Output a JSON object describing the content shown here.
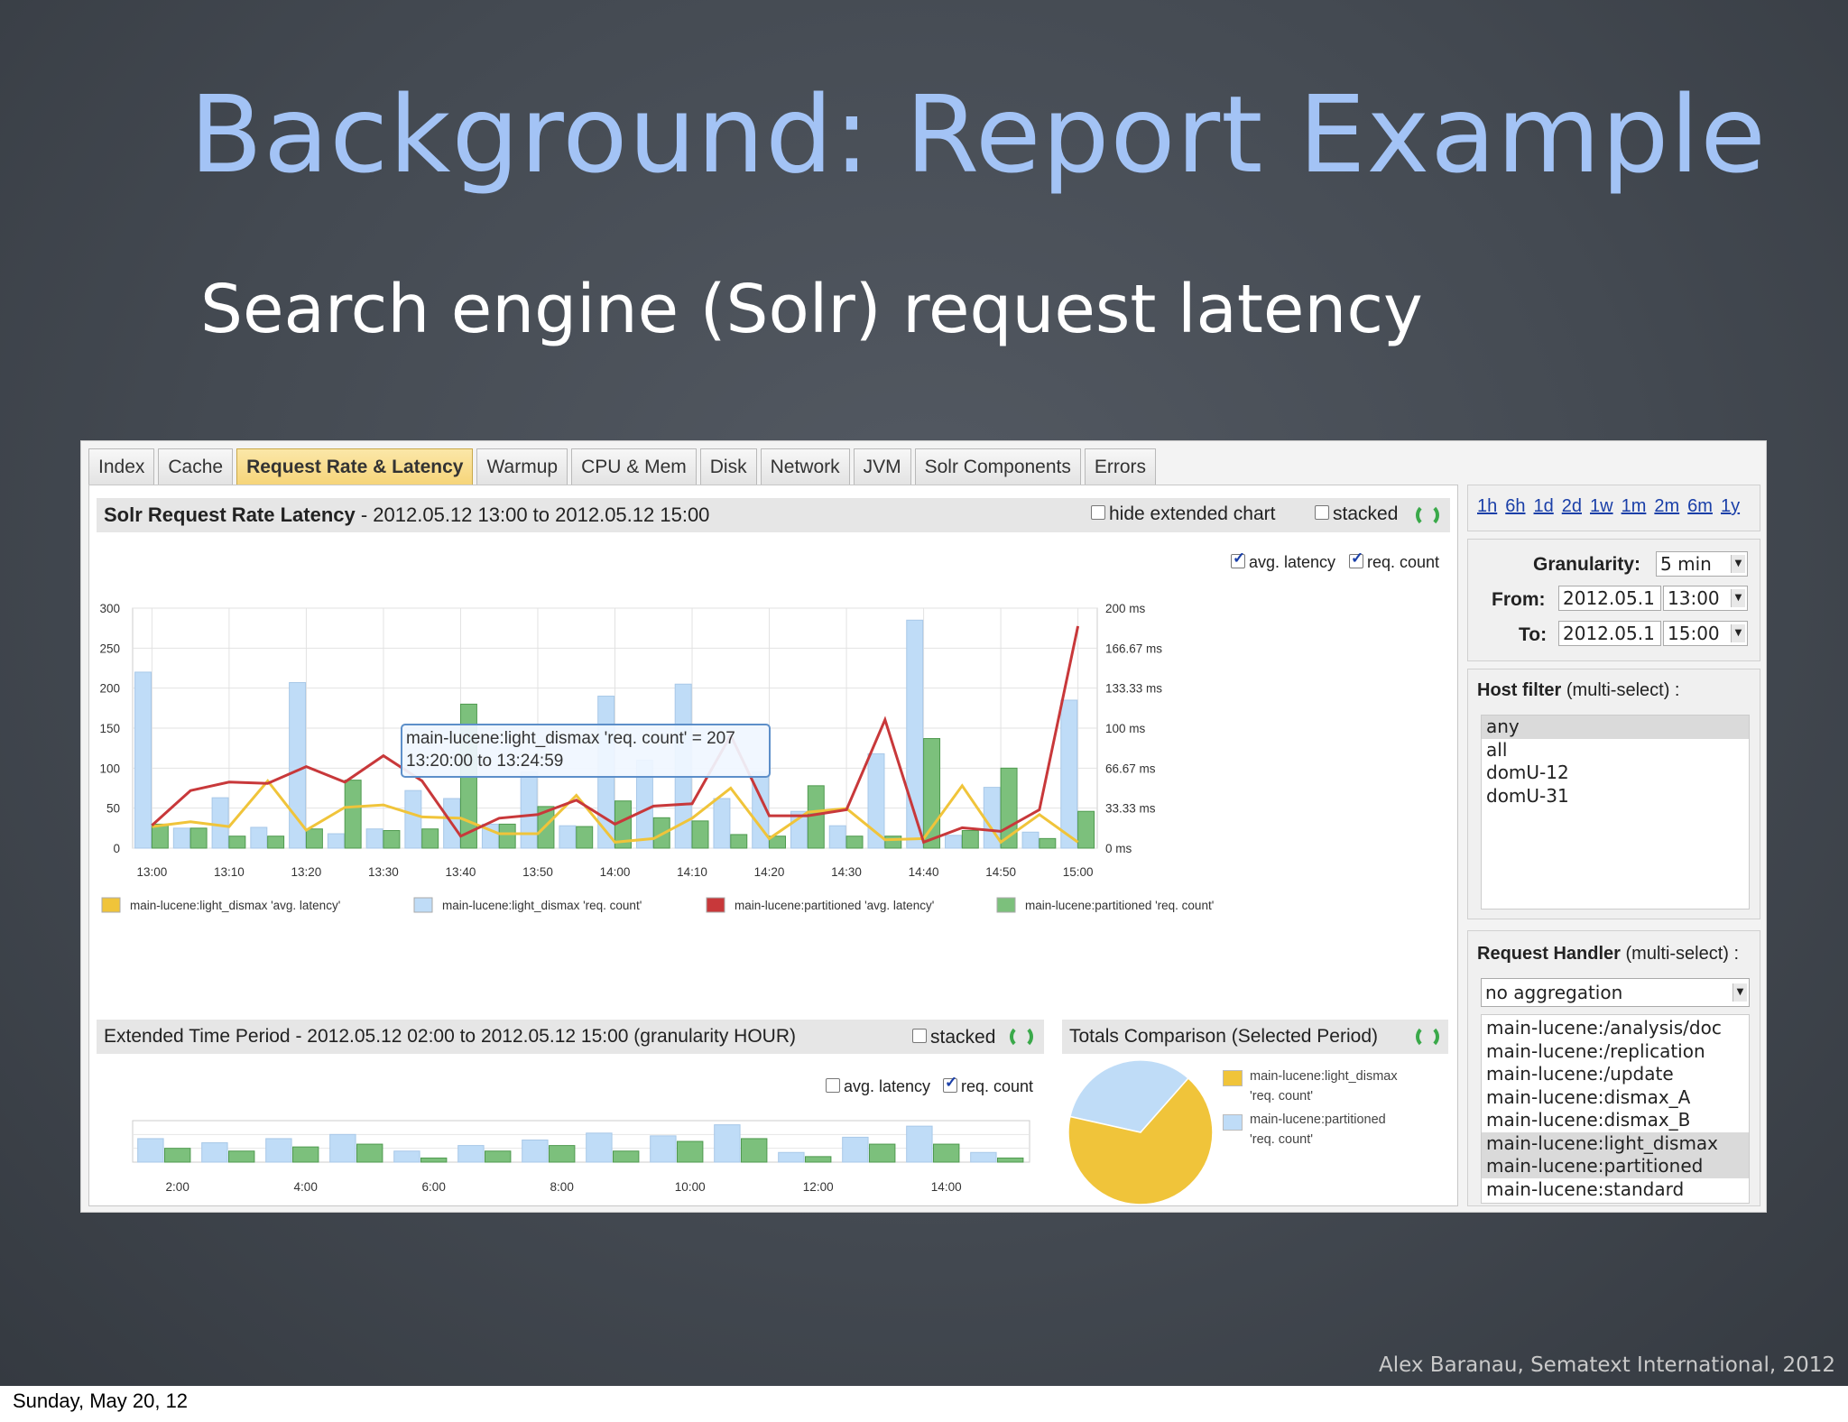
{
  "slide": {
    "title": "Background: Report Example",
    "subtitle": "Search engine (Solr) request latency",
    "credit": "Alex Baranau, Sematext International, 2012",
    "footer_date": "Sunday, May 20, 12"
  },
  "tabs": [
    "Index",
    "Cache",
    "Request Rate & Latency",
    "Warmup",
    "CPU & Mem",
    "Disk",
    "Network",
    "JVM",
    "Solr Components",
    "Errors"
  ],
  "active_tab": "Request Rate & Latency",
  "main_panel": {
    "title": "Solr Request Rate Latency",
    "range": " - 2012.05.12 13:00 to 2012.05.12 15:00",
    "hide_extended_label": "hide extended chart",
    "stacked_label": "stacked",
    "avg_latency_label": "avg. latency",
    "req_count_label": "req. count",
    "tooltip_line1": "main-lucene:light_dismax 'req. count' = 207",
    "tooltip_line2": "13:20:00 to 13:24:59"
  },
  "extended_panel": {
    "title": "Extended Time Period - 2012.05.12 02:00 to 2012.05.12 15:00 (granularity HOUR)",
    "stacked_label": "stacked",
    "avg_latency_label": "avg. latency",
    "req_count_label": "req. count"
  },
  "totals_panel": {
    "title": "Totals Comparison (Selected Period)",
    "legend1a": "main-lucene:light_dismax",
    "legend1b": "'req. count'",
    "legend2a": "main-lucene:partitioned",
    "legend2b": "'req. count'"
  },
  "sidebar": {
    "time_links": [
      "1h",
      "6h",
      "1d",
      "2d",
      "1w",
      "1m",
      "2m",
      "6m",
      "1y"
    ],
    "granularity_label": "Granularity:",
    "granularity_value": "5 min",
    "from_label": "From:",
    "from_date": "2012.05.1",
    "from_time": "13:00",
    "to_label": "To:",
    "to_date": "2012.05.1",
    "to_time": "15:00",
    "host_filter_label": "Host filter",
    "host_filter_hint": " (multi-select) :",
    "hosts": [
      "any",
      "all",
      "domU-12",
      "domU-31"
    ],
    "handler_label": "Request Handler",
    "handler_hint": " (multi-select) :",
    "aggregation_value": "no aggregation",
    "handlers": [
      "main-lucene:/analysis/doc",
      "main-lucene:/replication",
      "main-lucene:/update",
      "main-lucene:dismax_A",
      "main-lucene:dismax_B",
      "main-lucene:light_dismax",
      "main-lucene:partitioned",
      "main-lucene:standard"
    ]
  },
  "colors": {
    "yellow": "#f0c43a",
    "light_blue": "#bfdcf7",
    "red": "#c8383a",
    "green": "#7cc07c",
    "tab_active": "#f6d57a",
    "link": "#1a3fa8"
  },
  "chart_data": [
    {
      "type": "bar+line",
      "title": "Solr Request Rate Latency",
      "x": [
        "13:00",
        "13:05",
        "13:10",
        "13:15",
        "13:20",
        "13:25",
        "13:30",
        "13:35",
        "13:40",
        "13:45",
        "13:50",
        "13:55",
        "14:00",
        "14:05",
        "14:10",
        "14:15",
        "14:20",
        "14:25",
        "14:30",
        "14:35",
        "14:40",
        "14:45",
        "14:50",
        "14:55",
        "15:00"
      ],
      "x_tick_labels": [
        "13:00",
        "13:10",
        "13:20",
        "13:30",
        "13:40",
        "13:50",
        "14:00",
        "14:10",
        "14:20",
        "14:30",
        "14:40",
        "14:50",
        "15:00"
      ],
      "y_left_ticks": [
        "300",
        "250",
        "200",
        "150",
        "100",
        "50",
        "0"
      ],
      "ylim_left": [
        0,
        300
      ],
      "y_right_ticks": [
        "200 ms",
        "166.67 ms",
        "133.33 ms",
        "100 ms",
        "66.67 ms",
        "33.33 ms",
        "0 ms"
      ],
      "ylim_right_ms": [
        0,
        200
      ],
      "series": [
        {
          "name": "main-lucene:light_dismax 'req. count'",
          "kind": "bar",
          "axis": "left",
          "color": "#bfdcf7",
          "values": [
            220,
            25,
            63,
            26,
            207,
            18,
            24,
            72,
            62,
            30,
            95,
            28,
            190,
            110,
            205,
            62,
            95,
            46,
            28,
            118,
            285,
            16,
            76,
            20,
            185
          ]
        },
        {
          "name": "main-lucene:partitioned 'req. count'",
          "kind": "bar",
          "axis": "left",
          "color": "#7cc07c",
          "values": [
            30,
            25,
            15,
            15,
            24,
            85,
            22,
            24,
            180,
            30,
            52,
            27,
            59,
            38,
            34,
            17,
            15,
            78,
            15,
            15,
            137,
            22,
            100,
            12,
            46
          ]
        },
        {
          "name": "main-lucene:light_dismax 'avg. latency'",
          "kind": "line",
          "axis": "right",
          "color": "#f0c43a",
          "values": [
            18,
            22,
            18,
            56,
            15,
            34,
            36,
            26,
            25,
            12,
            12,
            44,
            5,
            8,
            25,
            50,
            8,
            30,
            33,
            7,
            8,
            52,
            5,
            28,
            5
          ]
        },
        {
          "name": "main-lucene:partitioned 'avg. latency'",
          "kind": "line",
          "axis": "right",
          "color": "#c8383a",
          "values": [
            19,
            48,
            55,
            54,
            68,
            55,
            77,
            56,
            10,
            25,
            28,
            40,
            20,
            35,
            37,
            94,
            27,
            27,
            32,
            107,
            5,
            17,
            14,
            32,
            185
          ]
        }
      ],
      "legend": [
        "main-lucene:light_dismax 'avg. latency'",
        "main-lucene:light_dismax 'req. count'",
        "main-lucene:partitioned 'avg. latency'",
        "main-lucene:partitioned 'req. count'"
      ]
    },
    {
      "type": "bar",
      "title": "Extended Time Period",
      "x_tick_labels": [
        "2:00",
        "4:00",
        "6:00",
        "8:00",
        "10:00",
        "12:00",
        "14:00"
      ],
      "series": [
        {
          "name": "main-lucene:light_dismax 'req. count'",
          "color": "#bfdcf7",
          "values": [
            85,
            70,
            85,
            100,
            40,
            60,
            80,
            105,
            95,
            135,
            35,
            90,
            130,
            35
          ]
        },
        {
          "name": "main-lucene:partitioned 'req. count'",
          "color": "#7cc07c",
          "values": [
            50,
            40,
            55,
            65,
            15,
            40,
            60,
            40,
            75,
            85,
            20,
            65,
            65,
            15
          ]
        }
      ]
    },
    {
      "type": "pie",
      "title": "Totals Comparison (Selected Period)",
      "slices": [
        {
          "name": "main-lucene:light_dismax 'req. count'",
          "value": 33,
          "color": "#bfdcf7"
        },
        {
          "name": "main-lucene:partitioned 'req. count'",
          "value": 67,
          "color": "#f0c43a"
        }
      ]
    }
  ]
}
